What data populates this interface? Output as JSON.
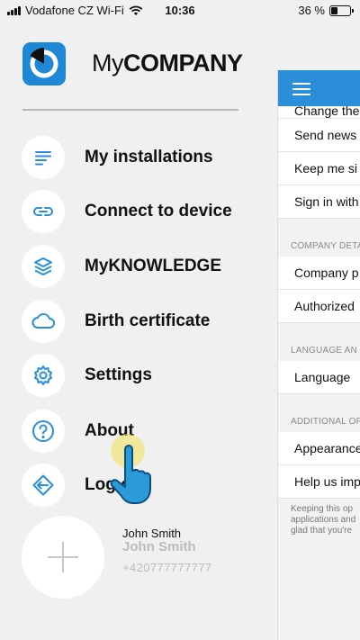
{
  "status_bar": {
    "carrier": "Vodafone CZ Wi-Fi",
    "time": "10:36",
    "battery_text": "36 %",
    "battery_level": 0.36
  },
  "drawer": {
    "brand_light": "My",
    "brand_bold": "COMPANY",
    "menu": [
      {
        "label": "My installations",
        "icon": "list-icon"
      },
      {
        "label": "Connect to device",
        "icon": "link-icon"
      },
      {
        "label": "MyKNOWLEDGE",
        "icon": "layers-icon"
      },
      {
        "label": "Birth certificate",
        "icon": "cloud-icon"
      },
      {
        "label": "Settings",
        "icon": "gear-icon"
      },
      {
        "label": "About",
        "icon": "help-icon"
      },
      {
        "label": "Log out",
        "icon": "logout-icon"
      }
    ],
    "profile": {
      "name": "John Smith",
      "name_bold": "John Smith",
      "phone": "+420777777777",
      "icon": "plus-icon"
    }
  },
  "background_panel": {
    "rows_top": [
      "Change the",
      "Send news",
      "Keep me si",
      "Sign in with"
    ],
    "section_company": "COMPANY DETA",
    "rows_company": [
      "Company p",
      "Authorized"
    ],
    "section_language": "LANGUAGE AN",
    "rows_language": [
      "Language"
    ],
    "section_additional": "ADDITIONAL OF",
    "rows_additional": [
      "Appearance",
      "Help us imp"
    ],
    "footer": [
      "Keeping this op",
      "applications and",
      "glad that you're"
    ]
  },
  "colors": {
    "brand_blue": "#1e88d6",
    "header_blue": "#2a8fd8",
    "drawer_bg": "#f0f0f0",
    "icon_blue": "#2a8fd8"
  }
}
